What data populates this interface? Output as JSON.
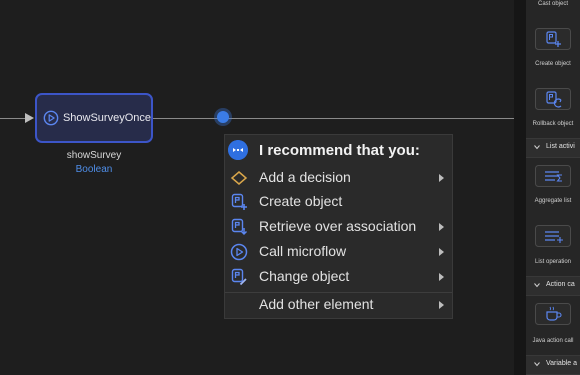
{
  "canvas": {
    "activity": {
      "label": "ShowSurveyOnce",
      "icon": "play-circle-icon"
    },
    "variable": {
      "name": "showSurvey",
      "type": "Boolean"
    }
  },
  "menu": {
    "title": "I recommend that you:",
    "items": [
      {
        "label": "Add a decision",
        "icon": "decision-diamond-icon",
        "submenu": true
      },
      {
        "label": "Create object",
        "icon": "create-object-icon",
        "submenu": false
      },
      {
        "label": "Retrieve over association",
        "icon": "retrieve-icon",
        "submenu": true
      },
      {
        "label": "Call microflow",
        "icon": "microflow-call-icon",
        "submenu": true
      },
      {
        "label": "Change object",
        "icon": "change-object-icon",
        "submenu": true
      },
      {
        "label": "Add other element",
        "icon": "",
        "submenu": true
      }
    ]
  },
  "toolbox": {
    "items": [
      {
        "label": "Cast object",
        "icon": ""
      },
      {
        "label": "Create object",
        "icon": "create-object-icon"
      },
      {
        "label": "Rollback object",
        "icon": "rollback-object-icon"
      },
      {
        "section": "List activi"
      },
      {
        "label": "Aggregate list",
        "icon": "aggregate-list-icon"
      },
      {
        "label": "List operation",
        "icon": "list-operation-icon"
      },
      {
        "section": "Action ca"
      },
      {
        "label": "Java action call",
        "icon": "java-action-icon"
      },
      {
        "section": "Variable a"
      }
    ]
  },
  "colors": {
    "canvas_bg": "#1e1e1e",
    "activity_border": "#3c55c8",
    "activity_fill": "#272c4a",
    "accent_blue": "#3b7ce6",
    "type_blue": "#4f8ee8",
    "decision_gold": "#d9a64a",
    "menu_bg": "#2a2a2a"
  }
}
